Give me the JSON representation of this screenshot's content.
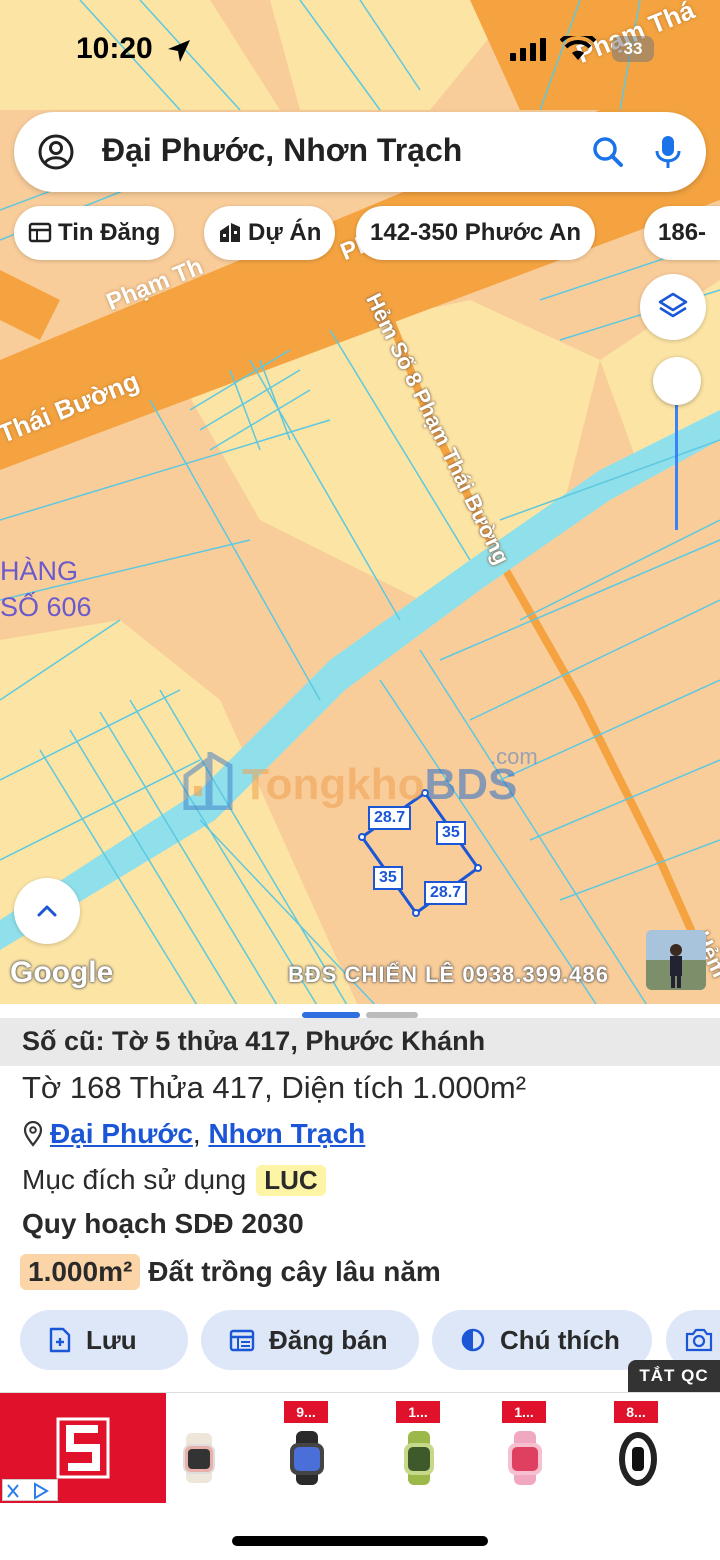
{
  "status": {
    "time": "10:20",
    "battery": "33"
  },
  "search": {
    "text": "Đại Phước, Nhơn Trạch",
    "icons": [
      "account-icon",
      "search-icon",
      "mic-icon"
    ]
  },
  "chips": [
    {
      "label": "Tin Đăng",
      "icon": "calendar-icon"
    },
    {
      "label": "Dự Án",
      "icon": "building-icon"
    },
    {
      "label": "142-350 Phước An"
    },
    {
      "label": "186-"
    }
  ],
  "map": {
    "road_labels": {
      "pham_thai_top": "Phạm Thá",
      "pham_th_left": "Phạm Th",
      "thai_buong": "Thái Bường",
      "hem": "Hẻm Số 8 Phạm Thái Bường",
      "hem_right": "Hẻm",
      "ph_mid": "Ph"
    },
    "poi_label": [
      "HÀNG",
      "SỐ 606"
    ],
    "parcel_dimensions": [
      "28.7",
      "35",
      "35",
      "28.7"
    ],
    "watermark": {
      "brand_a": "Tongkho",
      "brand_b": "BDS",
      "suffix": ".com"
    },
    "google": "Google",
    "credit": "BĐS CHIẾN LÊ 0938.399.486",
    "colors": {
      "land": "#f9cd9a",
      "residential": "#fbe4a4",
      "main_road": "#f4a340",
      "canal": "#8fe0ea",
      "parcel_lines": "#5ec8e0"
    }
  },
  "panel": {
    "old_id": "Số cũ: Tờ 5 thửa 417, Phước Khánh",
    "parcel": "Tờ 168 Thửa 417, Diện tích 1.000m²",
    "location": {
      "ward": "Đại Phước",
      "separator": ", ",
      "district": "Nhơn Trạch"
    },
    "usage_label": "Mục đích sử dụng",
    "usage_code": "LUC",
    "plan_title": "Quy hoạch SDĐ 2030",
    "plan_area": "1.000m²",
    "plan_type": "Đất trồng cây lâu năm",
    "actions": [
      {
        "label": "Lưu",
        "icon": "save-doc-icon"
      },
      {
        "label": "Đăng bán",
        "icon": "calendar-list-icon"
      },
      {
        "label": "Chú thích",
        "icon": "contrast-icon"
      }
    ]
  },
  "ad": {
    "close_label": "TẮT QC",
    "prices": [
      "9...",
      "1...",
      "1...",
      "8..."
    ]
  }
}
